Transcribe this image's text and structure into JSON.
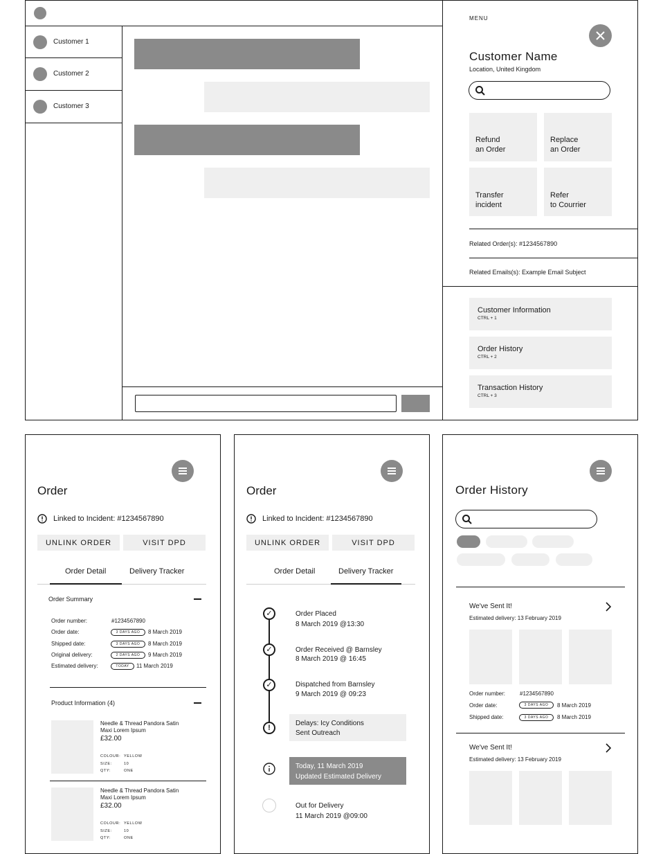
{
  "chat": {
    "customers": [
      {
        "name": "Customer 1"
      },
      {
        "name": "Customer 2"
      },
      {
        "name": "Customer 3"
      }
    ]
  },
  "menu": {
    "label": "MENU",
    "customer_name": "Customer Name",
    "location": "Location, United Kingdom",
    "actions": [
      {
        "line1": "Refund",
        "line2": "an Order"
      },
      {
        "line1": "Replace",
        "line2": "an Order"
      },
      {
        "line1": "Transfer",
        "line2": "incident"
      },
      {
        "line1": "Refer",
        "line2": "to Courrier"
      }
    ],
    "related_orders": "Related Order(s): #1234567890",
    "related_emails": "Related Emails(s): Example Email Subject",
    "shortcuts": [
      {
        "label": "Customer Information",
        "key": "CTRL + 1"
      },
      {
        "label": "Order History",
        "key": "CTRL + 2"
      },
      {
        "label": "Transaction History",
        "key": "CTRL + 3"
      }
    ]
  },
  "order": {
    "title": "Order",
    "linked": "Linked to Incident: #1234567890",
    "unlink": "UNLINK ORDER",
    "visit": "VISIT DPD",
    "tab_detail": "Order Detail",
    "tab_tracker": "Delivery Tracker",
    "summary_title": "Order Summary",
    "summary": [
      {
        "label": "Order number:",
        "badge": "",
        "value": "#1234567890"
      },
      {
        "label": "Order date:",
        "badge": "3 DAYS AGO",
        "value": "8 March 2019"
      },
      {
        "label": "Shipped date:",
        "badge": "3 DAYS AGO",
        "value": "8 March 2019"
      },
      {
        "label": "Original delivery:",
        "badge": "2 DAYS AGO",
        "value": "9 March 2019"
      },
      {
        "label": "Estimated delivery:",
        "badge": "TODAY",
        "value": "11 March 2019"
      }
    ],
    "product_title": "Product Information (4)",
    "products": [
      {
        "name1": "Needle & Thread Pandora Satin",
        "name2": "Maxi Lorem Ipsum",
        "price": "£32.00",
        "colour_label": "COLOUR:",
        "colour": "YELLOW",
        "size_label": "SIZE:",
        "size": "10",
        "qty_label": "QTY:",
        "qty": "ONE"
      },
      {
        "name1": "Needle & Thread Pandora Satin",
        "name2": "Maxi Lorem Ipsum",
        "price": "£32.00",
        "colour_label": "COLOUR:",
        "colour": "YELLOW",
        "size_label": "SIZE:",
        "size": "10",
        "qty_label": "QTY:",
        "qty": "ONE"
      }
    ]
  },
  "tracker": {
    "steps": [
      {
        "line1": "Order Placed",
        "line2": "8 March 2019 @13:30",
        "state": "done"
      },
      {
        "line1": "Order Received @ Barnsley",
        "line2": "8 March 2019 @ 16:45",
        "state": "done"
      },
      {
        "line1": "Dispatched from Barnsley",
        "line2": "9 March 2019 @ 09:23",
        "state": "done"
      },
      {
        "line1": "Delays: Icy Conditions",
        "line2": "Sent Outreach",
        "state": "alert"
      },
      {
        "line1": "Today, 11 March 2019",
        "line2": "Updated Estimated Delivery",
        "state": "info"
      },
      {
        "line1": "Out for Delivery",
        "line2": "11 March 2019 @09:00",
        "state": "pending"
      }
    ]
  },
  "history": {
    "title": "Order History",
    "cards": [
      {
        "heading": "We've Sent It!",
        "estimated": "Estimated delivery: 13 February 2019"
      },
      {
        "heading": "We've Sent It!",
        "estimated": "Estimated delivery: 13 February 2019"
      }
    ],
    "details": [
      {
        "label": "Order number:",
        "badge": "",
        "value": "#1234567890"
      },
      {
        "label": "Order date:",
        "badge": "3 DAYS AGO",
        "value": "8 March 2019"
      },
      {
        "label": "Shipped date:",
        "badge": "3 DAYS AGO",
        "value": "8 March 2019"
      }
    ]
  }
}
